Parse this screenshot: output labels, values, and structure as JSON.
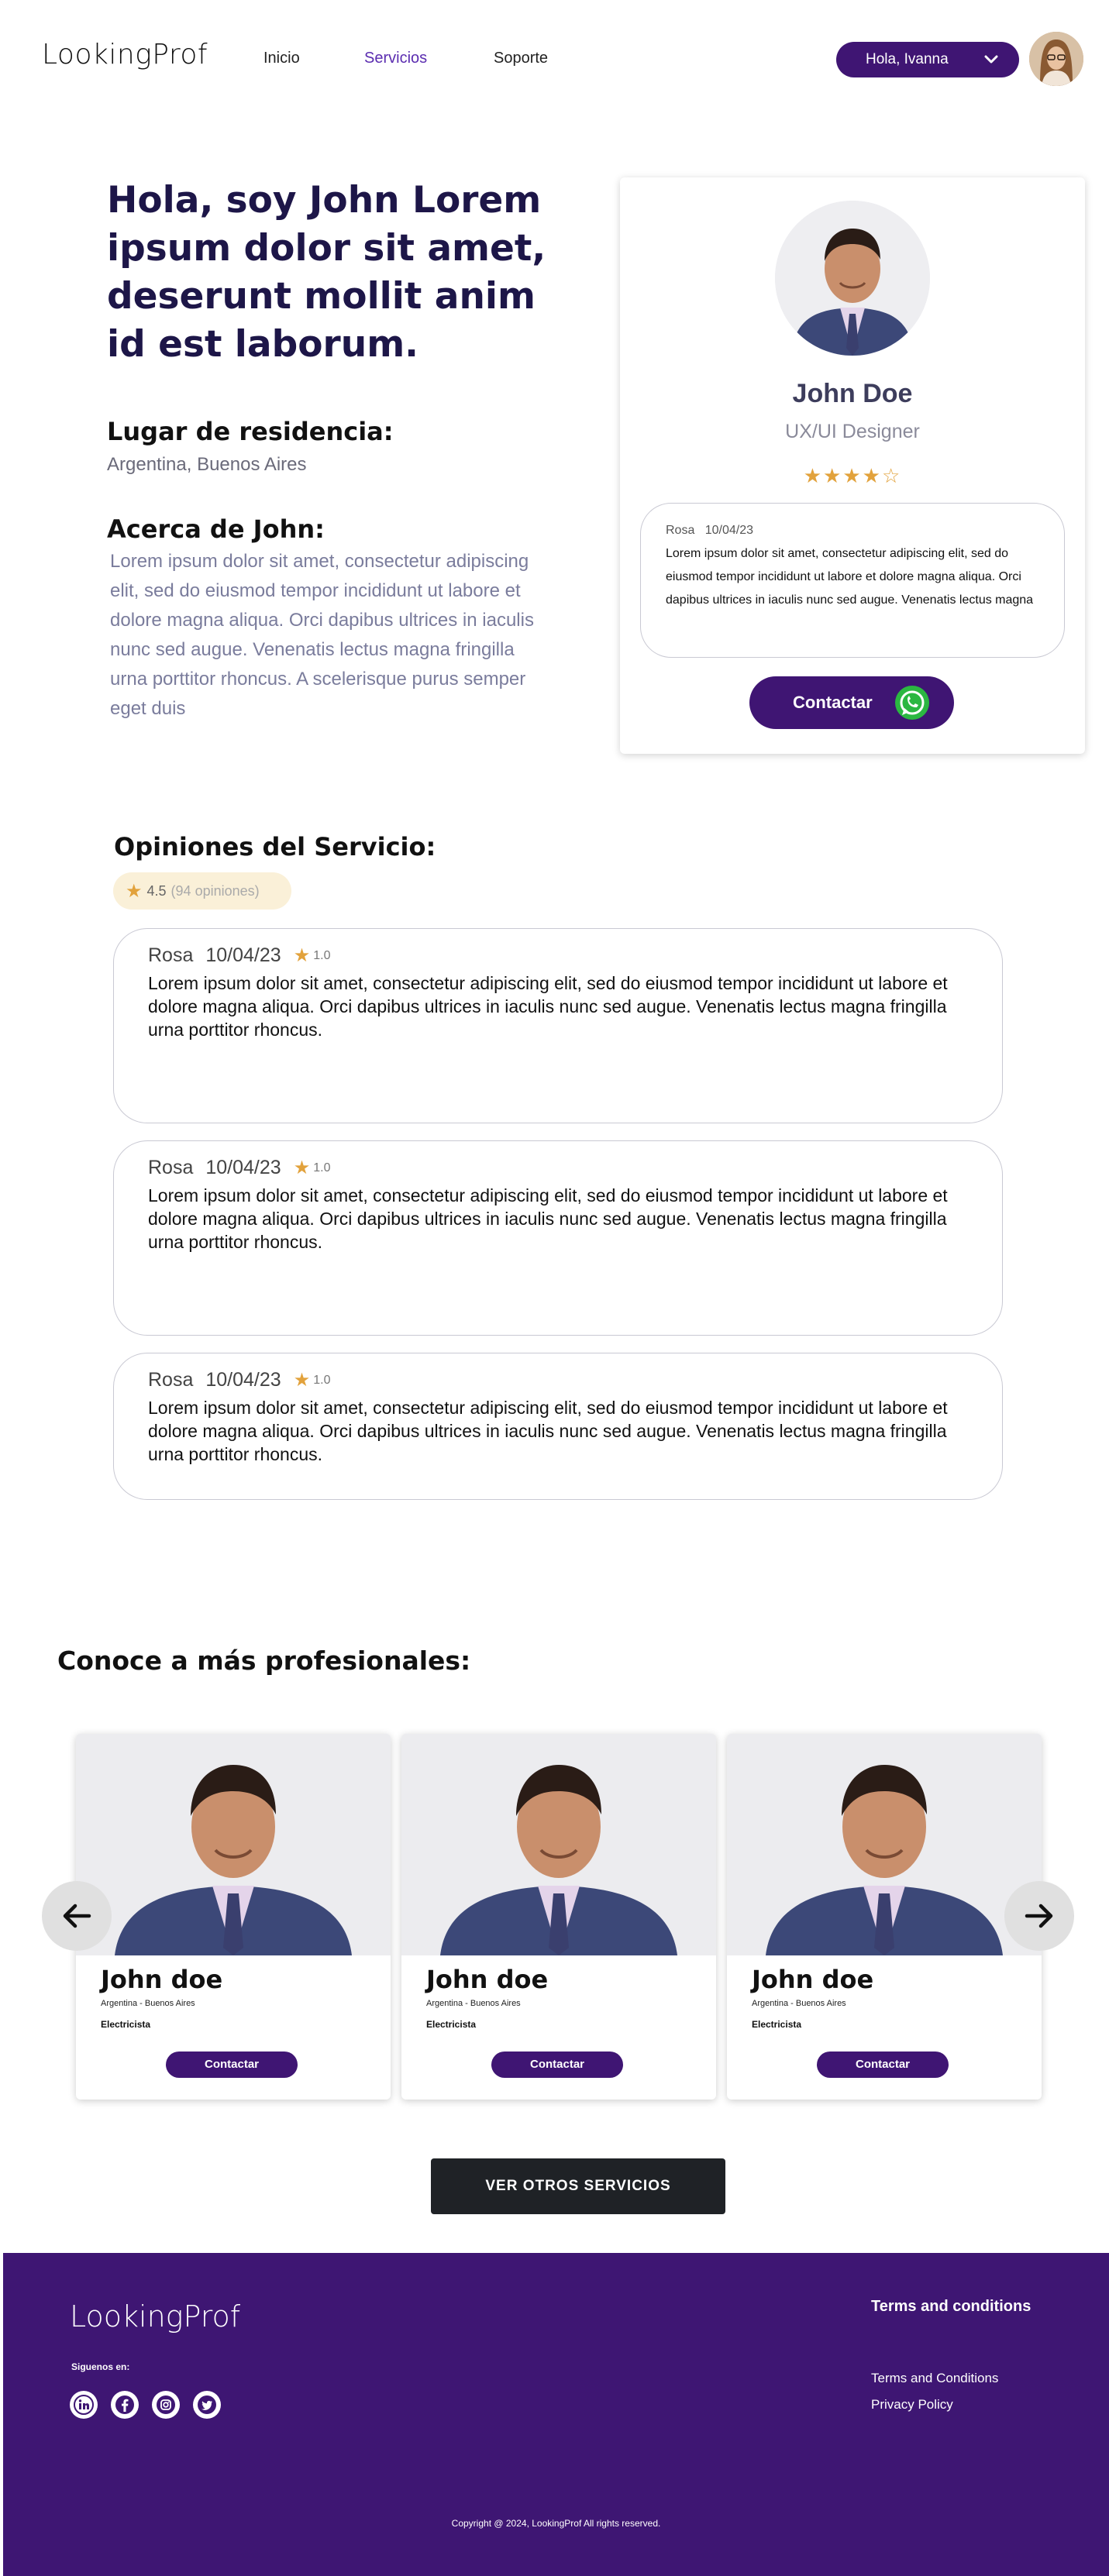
{
  "nav": {
    "logo": "LookingProf",
    "links": [
      "Inicio",
      "Servicios",
      "Soporte"
    ],
    "user_greeting": "Hola, Ivanna"
  },
  "hero": {
    "title": "Hola, soy John Lorem ipsum dolor sit amet, deserunt mollit anim id est laborum.",
    "residence_heading": "Lugar de residencia:",
    "residence_value": "Argentina, Buenos Aires",
    "about_heading": "Acerca de John:",
    "about_text": "Lorem ipsum dolor sit amet, consectetur adipiscing elit, sed do eiusmod tempor incididunt ut labore et dolore magna aliqua. Orci dapibus ultrices in iaculis nunc sed augue. Venenatis lectus magna fringilla urna porttitor rhoncus. A scelerisque purus semper eget duis"
  },
  "profile_card": {
    "name": "John Doe",
    "role": "UX/UI Designer",
    "rating": 4,
    "rating_max": 5,
    "review_author": "Rosa",
    "review_date": "10/04/23",
    "review_text": "Lorem ipsum dolor sit amet, consectetur adipiscing elit, sed do eiusmod tempor incididunt ut labore et dolore magna aliqua. Orci dapibus ultrices in iaculis nunc sed augue. Venenatis lectus magna",
    "contact_label": "Contactar"
  },
  "opinions": {
    "title": "Opiniones del Servicio:",
    "rating": "4.5",
    "count_label": "(94 opiniones)",
    "reviews": [
      {
        "author": "Rosa",
        "date": "10/04/23",
        "score": "1.0",
        "text": "Lorem ipsum dolor sit amet, consectetur adipiscing elit, sed do eiusmod tempor incididunt ut labore et dolore magna aliqua. Orci dapibus ultrices in iaculis nunc sed augue. Venenatis lectus magna fringilla urna porttitor rhoncus."
      },
      {
        "author": "Rosa",
        "date": "10/04/23",
        "score": "1.0",
        "text": "Lorem ipsum dolor sit amet, consectetur adipiscing elit, sed do eiusmod tempor incididunt ut labore et dolore magna aliqua. Orci dapibus ultrices in iaculis nunc sed augue. Venenatis lectus magna fringilla urna porttitor rhoncus."
      },
      {
        "author": "Rosa",
        "date": "10/04/23",
        "score": "1.0",
        "text": "Lorem ipsum dolor sit amet, consectetur adipiscing elit, sed do eiusmod tempor incididunt ut labore et dolore magna aliqua. Orci dapibus ultrices in iaculis nunc sed augue. Venenatis lectus magna fringilla urna porttitor rhoncus."
      }
    ]
  },
  "more": {
    "title": "Conoce a más profesionales:",
    "cards": [
      {
        "name": "John doe",
        "location": "Argentina - Buenos Aires",
        "job": "Electricista",
        "button": "Contactar"
      },
      {
        "name": "John doe",
        "location": "Argentina - Buenos Aires",
        "job": "Electricista",
        "button": "Contactar"
      },
      {
        "name": "John doe",
        "location": "Argentina - Buenos Aires",
        "job": "Electricista",
        "button": "Contactar"
      }
    ],
    "cta": "VER OTROS SERVICIOS"
  },
  "footer": {
    "logo": "LookingProf",
    "follow_label": "Siguenos en:",
    "social": [
      "linkedin-icon",
      "facebook-icon",
      "instagram-icon",
      "twitter-icon"
    ],
    "terms_heading": "Terms and conditions",
    "links": [
      "Terms and Conditions",
      "Privacy Policy"
    ],
    "copyright": "Copyright @ 2024, LookingProf All rights reserved."
  },
  "colors": {
    "brand": "#3f1573",
    "nav_active": "#5b2db0",
    "hero_title": "#1d1648",
    "star": "#e2a23c",
    "cta_dark": "#1f2226"
  }
}
